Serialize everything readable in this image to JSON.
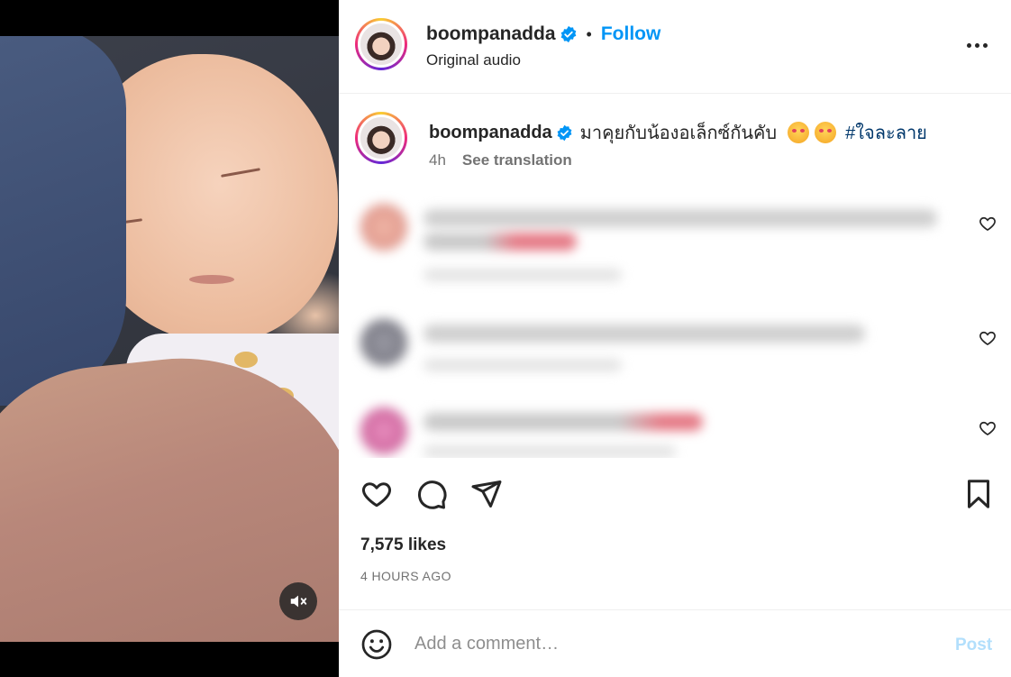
{
  "header": {
    "username": "boompanadda",
    "follow_label": "Follow",
    "separator": "•",
    "audio_label": "Original audio",
    "verified_icon": "verified-badge-icon",
    "more_icon": "more-options-icon"
  },
  "caption": {
    "username": "boompanadda",
    "text": "มาคุยกับน้องอเล็กซ์กันคับ",
    "emojis": [
      "smiling-face-with-hearts",
      "smiling-face-with-hearts"
    ],
    "hashtag": "#ใจละลาย",
    "time_ago": "4h",
    "translate_label": "See translation"
  },
  "comments": [
    {
      "blurred": true,
      "likeable": true
    },
    {
      "blurred": true,
      "likeable": true
    },
    {
      "blurred": true,
      "likeable": true
    }
  ],
  "actions": {
    "like_icon": "heart-icon",
    "comment_icon": "comment-icon",
    "share_icon": "share-icon",
    "save_icon": "bookmark-icon"
  },
  "stats": {
    "likes": "7,575 likes",
    "posted": "4 HOURS AGO"
  },
  "comment_bar": {
    "placeholder": "Add a comment…",
    "post_label": "Post",
    "emoji_icon": "emoji-icon"
  },
  "media": {
    "mute_icon": "speaker-muted-icon"
  },
  "colors": {
    "accent": "#0095f6",
    "verified": "#0095f6",
    "hashtag": "#00376b",
    "post_disabled": "#b2dffc",
    "secondary_text": "#737373"
  }
}
